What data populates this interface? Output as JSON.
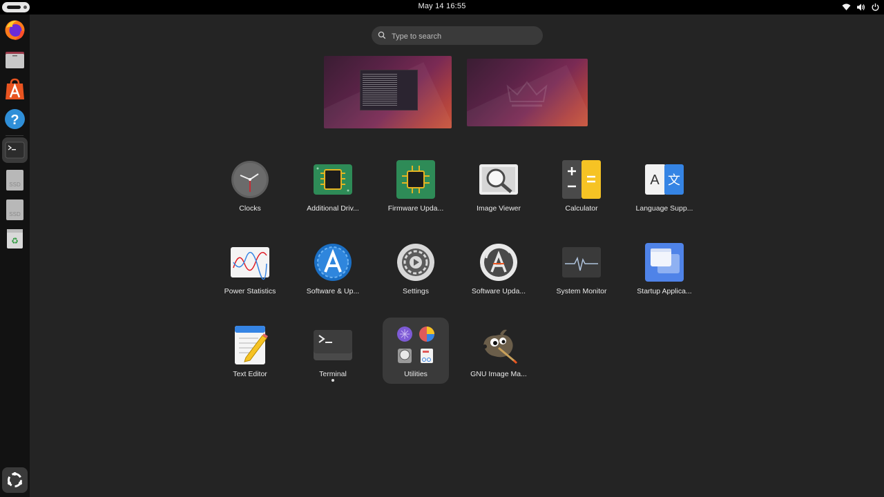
{
  "topbar": {
    "datetime": "May 14  16:55",
    "tray_icons": [
      "wifi-icon",
      "volume-icon",
      "power-icon"
    ]
  },
  "dock": {
    "items": [
      {
        "name": "firefox-icon"
      },
      {
        "name": "files-icon"
      },
      {
        "name": "app-center-icon"
      },
      {
        "name": "help-icon"
      },
      {
        "name": "terminal-icon",
        "active": true
      },
      {
        "name": "ssd-drive-icon",
        "label": "SSD"
      },
      {
        "name": "ssd-drive-icon",
        "label": "SSD"
      },
      {
        "name": "trash-icon"
      }
    ],
    "show_apps": "show-apps-icon"
  },
  "search": {
    "placeholder": "Type to search"
  },
  "workspaces": [
    {
      "name": "workspace-1",
      "has_terminal_window": true
    },
    {
      "name": "workspace-2",
      "has_terminal_window": false
    }
  ],
  "apps": [
    {
      "label": "Clocks",
      "icon": "clocks-icon"
    },
    {
      "label": "Additional Driv...",
      "icon": "additional-drivers-icon"
    },
    {
      "label": "Firmware Upda...",
      "icon": "firmware-updater-icon"
    },
    {
      "label": "Image Viewer",
      "icon": "image-viewer-icon"
    },
    {
      "label": "Calculator",
      "icon": "calculator-icon"
    },
    {
      "label": "Language Supp...",
      "icon": "language-support-icon"
    },
    {
      "label": "Power Statistics",
      "icon": "power-statistics-icon"
    },
    {
      "label": "Software & Up...",
      "icon": "software-updates-icon"
    },
    {
      "label": "Settings",
      "icon": "settings-icon"
    },
    {
      "label": "Software Upda...",
      "icon": "software-updater-icon"
    },
    {
      "label": "System Monitor",
      "icon": "system-monitor-icon"
    },
    {
      "label": "Startup Applica...",
      "icon": "startup-applications-icon"
    },
    {
      "label": "Text Editor",
      "icon": "text-editor-icon"
    },
    {
      "label": "Terminal",
      "icon": "terminal-icon",
      "running": true
    },
    {
      "label": "Utilities",
      "icon": "utilities-folder-icon",
      "selected": true
    },
    {
      "label": "GNU Image Ma...",
      "icon": "gimp-icon"
    }
  ],
  "colors": {
    "background": "#242424",
    "topbar": "#000000",
    "dock": "#121212",
    "accent_orange": "#e95420"
  }
}
